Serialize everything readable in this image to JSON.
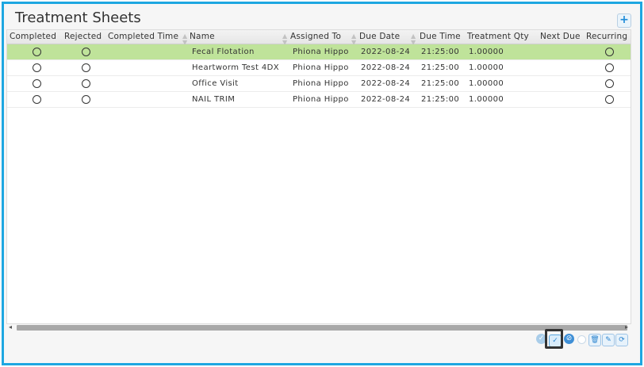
{
  "window": {
    "title": "Treatment Sheets"
  },
  "columns": [
    "Completed",
    "Rejected",
    "Completed Time",
    "Name",
    "Assigned To",
    "Due Date",
    "Due Time",
    "Treatment Qty",
    "Next Due",
    "Recurring"
  ],
  "rows": [
    {
      "name": "Fecal Flotation",
      "assigned_to": "Phiona Hippo",
      "due_date": "2022-08-24",
      "due_time": "21:25:00",
      "treatment_qty": "1.00000",
      "selected": true
    },
    {
      "name": "Heartworm Test 4DX",
      "assigned_to": "Phiona Hippo",
      "due_date": "2022-08-24",
      "due_time": "21:25:00",
      "treatment_qty": "1.00000",
      "selected": false
    },
    {
      "name": "Office Visit",
      "assigned_to": "Phiona Hippo",
      "due_date": "2022-08-24",
      "due_time": "21:25:00",
      "treatment_qty": "1.00000",
      "selected": false
    },
    {
      "name": "NAIL TRIM",
      "assigned_to": "Phiona Hippo",
      "due_date": "2022-08-24",
      "due_time": "21:25:00",
      "treatment_qty": "1.00000",
      "selected": false
    }
  ],
  "toolbar": {
    "icons": [
      "circle-check-icon",
      "check-icon",
      "reject-icon",
      "small-circle-icon",
      "trash-icon",
      "edit-icon",
      "refresh-icon"
    ],
    "add_icon": "plus-icon"
  },
  "colors": {
    "accent": "#1ea7e1",
    "selected_row": "#bfe39a"
  }
}
